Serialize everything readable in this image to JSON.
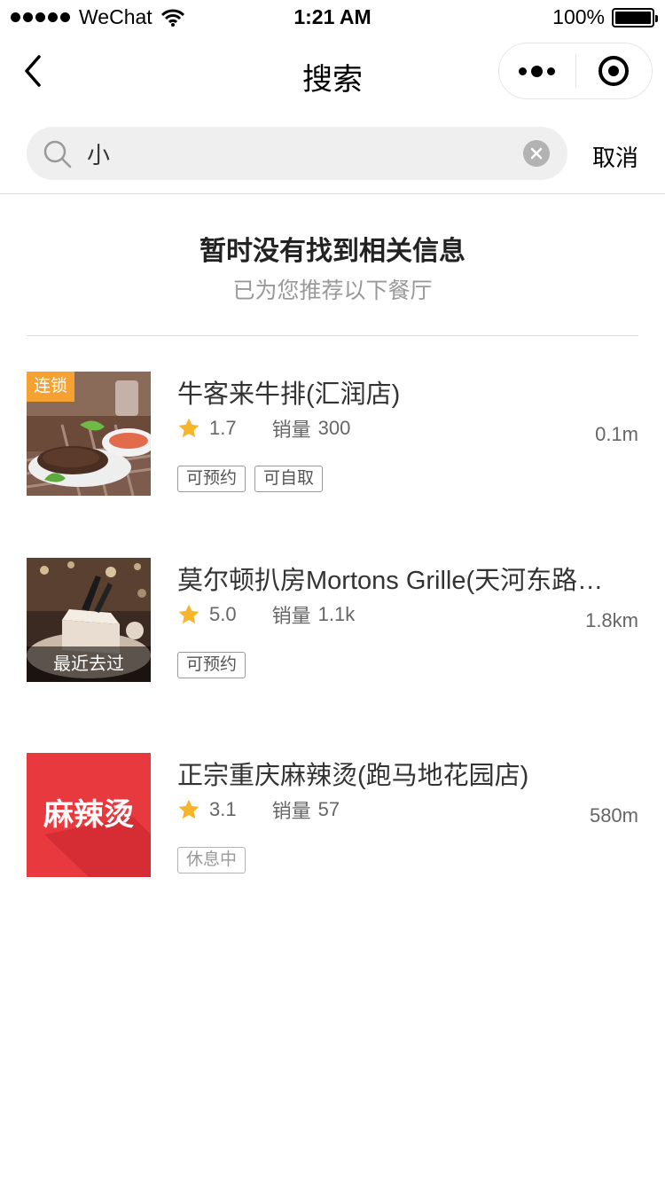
{
  "status_bar": {
    "carrier": "WeChat",
    "time": "1:21 AM",
    "battery": "100%"
  },
  "nav": {
    "title": "搜索"
  },
  "search": {
    "value": "小",
    "cancel_label": "取消"
  },
  "empty_notice": {
    "title": "暂时没有找到相关信息",
    "subtitle": "已为您推荐以下餐厅"
  },
  "restaurants": [
    {
      "name": "牛客来牛排(汇润店)",
      "rating": "1.7",
      "sales_label": "销量",
      "sales": "300",
      "distance": "0.1m",
      "badge": "连锁",
      "tags": [
        "可预约",
        "可自取"
      ]
    },
    {
      "name": "莫尔顿扒房Mortons Grille(天河东路…",
      "rating": "5.0",
      "sales_label": "销量",
      "sales": "1.1k",
      "distance": "1.8km",
      "badge": "最近去过",
      "tags": [
        "可预约"
      ]
    },
    {
      "name": "正宗重庆麻辣烫(跑马地花园店)",
      "rating": "3.1",
      "sales_label": "销量",
      "sales": "57",
      "distance": "580m",
      "logo_text": "麻辣烫",
      "tags": [
        "休息中"
      ]
    }
  ],
  "colors": {
    "chain_badge": "#f5a233",
    "star": "#f7b52c",
    "logo_bg": "#e8393f"
  }
}
